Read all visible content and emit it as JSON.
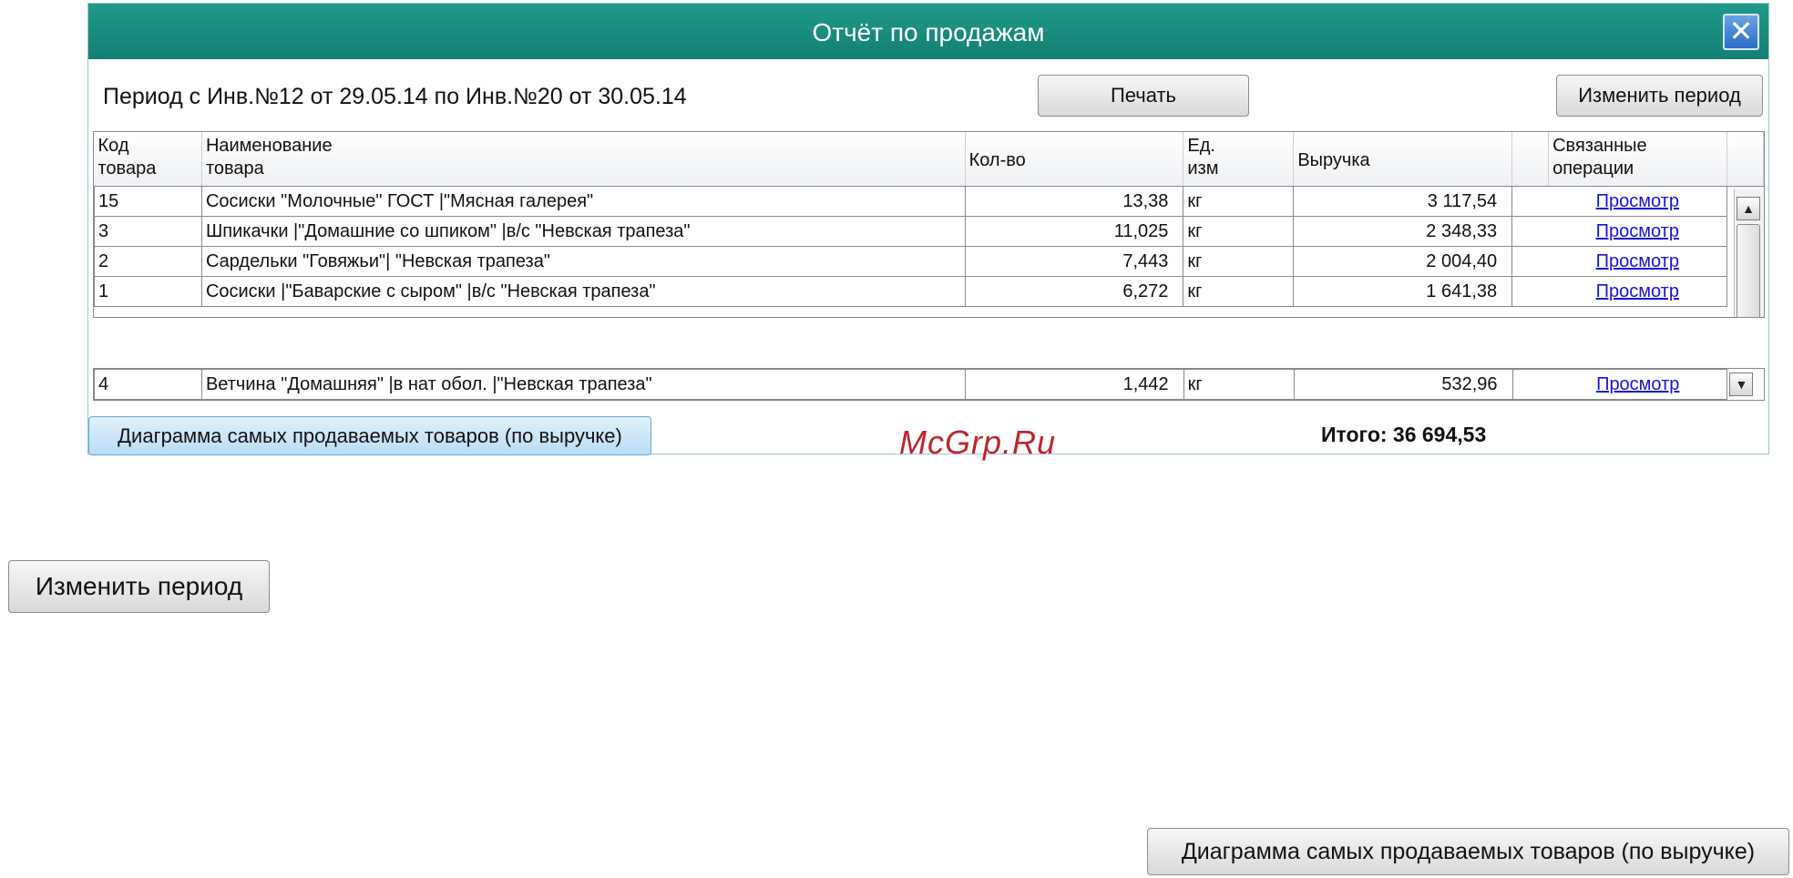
{
  "dialog": {
    "title": "Отчёт по продажам",
    "close_icon": "close-icon",
    "period_text": "Период с Инв.№12 от 29.05.14  по  Инв.№20 от 30.05.14",
    "print_label": "Печать",
    "change_period_label": "Изменить период",
    "chart_button_label": "Диаграмма самых продаваемых товаров (по выручке)",
    "total_text": "Итого: 36 694,53"
  },
  "table": {
    "headers": {
      "code": "Код\nтовара",
      "name": "Наименование\nтовара",
      "qty": "Кол-во",
      "unit": "Ед.\nизм",
      "revenue": "Выручка",
      "related": "Связанные\nоперации"
    },
    "rows": [
      {
        "code": "15",
        "name": "Сосиски \"Молочные\" ГОСТ |\"Мясная галерея\"",
        "qty": "13,38",
        "unit": "кг",
        "revenue": "3 117,54",
        "link": "Просмотр"
      },
      {
        "code": "3",
        "name": "Шпикачки |\"Домашние со шпиком\" |в/с  \"Невская трапеза\"",
        "qty": "11,025",
        "unit": "кг",
        "revenue": "2 348,33",
        "link": "Просмотр"
      },
      {
        "code": "2",
        "name": "Сардельки \"Говяжьи\"| \"Невская трапеза\"",
        "qty": "7,443",
        "unit": "кг",
        "revenue": "2 004,40",
        "link": "Просмотр"
      },
      {
        "code": "1",
        "name": "Сосиски |\"Баварские с сыром\" |в/с  \"Невская трапеза\"",
        "qty": "6,272",
        "unit": "кг",
        "revenue": "1 641,38",
        "link": "Просмотр"
      }
    ],
    "last_row": {
      "code": "4",
      "name": "Ветчина \"Домашняя\" |в нат обол. |\"Невская трапеза\"",
      "qty": "1,442",
      "unit": "кг",
      "revenue": "532,96",
      "link": "Просмотр"
    }
  },
  "watermark": "McGrp.Ru",
  "standalone": {
    "change_period_label": "Изменить период",
    "chart_button_label": "Диаграмма самых продаваемых товаров (по выручке)"
  }
}
